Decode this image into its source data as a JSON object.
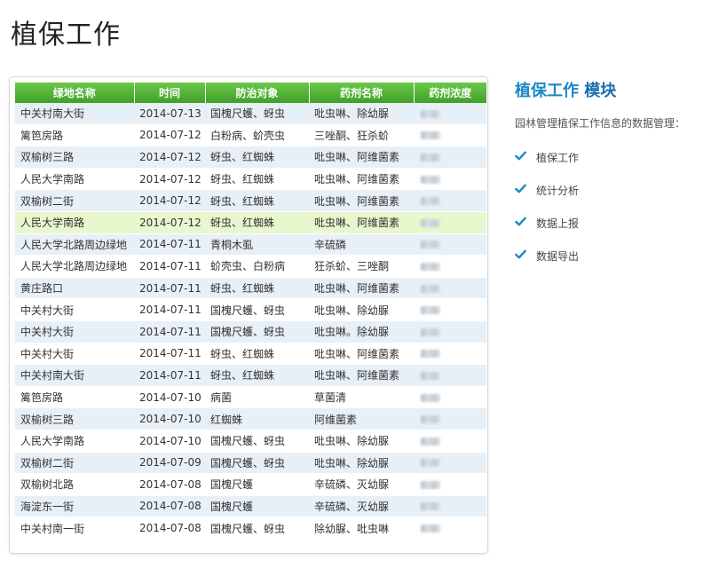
{
  "page": {
    "title": "植保工作"
  },
  "table": {
    "headers": [
      "绿地名称",
      "时间",
      "防治对象",
      "药剂名称",
      "药剂浓度"
    ],
    "rows": [
      [
        "中关村南大街",
        "2014-07-13",
        "国槐尺蠖、蚜虫",
        "吡虫啉、除幼脲"
      ],
      [
        "篱笆房路",
        "2014-07-12",
        "白粉病、蚧壳虫",
        "三唑酮、狂杀蚧"
      ],
      [
        "双榆树三路",
        "2014-07-12",
        "蚜虫、红蜘蛛",
        "吡虫啉、阿维菌素"
      ],
      [
        "人民大学南路",
        "2014-07-12",
        "蚜虫、红蜘蛛",
        "吡虫啉、阿维菌素"
      ],
      [
        "双榆树二街",
        "2014-07-12",
        "蚜虫、红蜘蛛",
        "吡虫啉、阿维菌素"
      ],
      [
        "人民大学南路",
        "2014-07-12",
        "蚜虫、红蜘蛛",
        "吡虫啉、阿维菌素"
      ],
      [
        "人民大学北路周边绿地",
        "2014-07-11",
        "青桐木虱",
        "辛硫磷"
      ],
      [
        "人民大学北路周边绿地",
        "2014-07-11",
        "蚧壳虫、白粉病",
        "狂杀蚧、三唑酮"
      ],
      [
        "黄庄路口",
        "2014-07-11",
        "蚜虫、红蜘蛛",
        "吡虫啉、阿维菌素"
      ],
      [
        "中关村大街",
        "2014-07-11",
        "国槐尺蠖、蚜虫",
        "吡虫啉、除幼脲"
      ],
      [
        "中关村大街",
        "2014-07-11",
        "国槐尺蠖、蚜虫",
        "吡虫啉。除幼脲"
      ],
      [
        "中关村大街",
        "2014-07-11",
        "蚜虫、红蜘蛛",
        "吡虫啉、阿维菌素"
      ],
      [
        "中关村南大街",
        "2014-07-11",
        "蚜虫、红蜘蛛",
        "吡虫啉、阿维菌素"
      ],
      [
        "篱笆房路",
        "2014-07-10",
        "病菌",
        "草菌清"
      ],
      [
        "双榆树三路",
        "2014-07-10",
        "红蜘蛛",
        "阿维菌素"
      ],
      [
        "人民大学南路",
        "2014-07-10",
        "国槐尺蠖、蚜虫",
        "吡虫啉、除幼脲"
      ],
      [
        "双榆树二街",
        "2014-07-09",
        "国槐尺蠖、蚜虫",
        "吡虫啉、除幼脲"
      ],
      [
        "双榆树北路",
        "2014-07-08",
        "国槐尺蠖",
        "辛硫磷、灭幼脲"
      ],
      [
        "海淀东一街",
        "2014-07-08",
        "国槐尺蠖",
        "辛硫磷、灭幼脲"
      ],
      [
        "中关村南一街",
        "2014-07-08",
        "国槐尺蠖、蚜虫",
        "除幼脲、吡虫啉"
      ]
    ],
    "highlight_row": 5
  },
  "side": {
    "title_prefix": "植保工作",
    "title_bold": "模块",
    "description": "园林管理植保工作信息的数据管理：",
    "features": [
      "植保工作",
      "统计分析",
      "数据上报",
      "数据导出"
    ]
  },
  "colors": {
    "header_green": "#4cae32",
    "row_blue": "#e8f0f7",
    "row_highlight": "#e9f7cf",
    "accent_blue": "#1a88c8"
  }
}
